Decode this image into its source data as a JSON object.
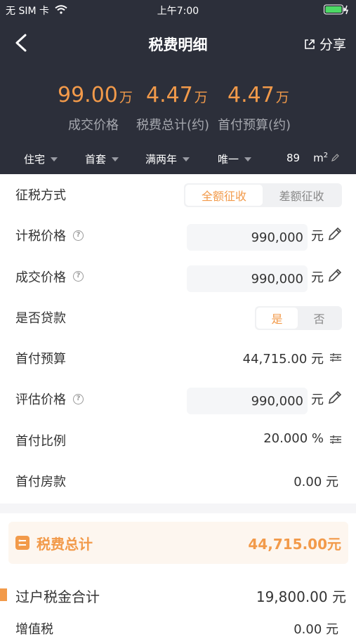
{
  "status": {
    "carrier": "无 SIM 卡",
    "time": "上午7:00"
  },
  "nav": {
    "title": "税费明细",
    "share": "分享"
  },
  "summary": [
    {
      "value": "99.00",
      "unit": "万",
      "label": "成交价格"
    },
    {
      "value": "4.47",
      "unit": "万",
      "label": "税费总计(约)"
    },
    {
      "value": "4.47",
      "unit": "万",
      "label": "首付预算(约)"
    }
  ],
  "filters": {
    "type": "住宅",
    "first": "首套",
    "years": "满两年",
    "only": "唯一",
    "area": "89",
    "area_unit": "m",
    "area_sup": "2"
  },
  "rows": {
    "tax_method": {
      "label": "征税方式",
      "opt1": "全额征收",
      "opt2": "差额征收"
    },
    "tax_price": {
      "label": "计税价格",
      "value": "990,000",
      "unit": "元"
    },
    "deal_price": {
      "label": "成交价格",
      "value": "990,000",
      "unit": "元"
    },
    "loan": {
      "label": "是否贷款",
      "yes": "是",
      "no": "否"
    },
    "down_budget": {
      "label": "首付预算",
      "value": "44,715.00 元"
    },
    "appraisal": {
      "label": "评估价格",
      "value": "990,000",
      "unit": "元"
    },
    "down_ratio": {
      "label": "首付比例",
      "value": "20.000 %"
    },
    "down_payment": {
      "label": "首付房款",
      "value": "0.00 元"
    }
  },
  "total": {
    "label": "税费总计",
    "value": "44,715.00元"
  },
  "section": {
    "label": "过户税金合计",
    "value": "19,800.00 元"
  },
  "vat": {
    "label": "增值税",
    "value": "0.00 元"
  },
  "colors": {
    "accent": "#f29a4a",
    "header_bg": "#2c2f3a"
  }
}
